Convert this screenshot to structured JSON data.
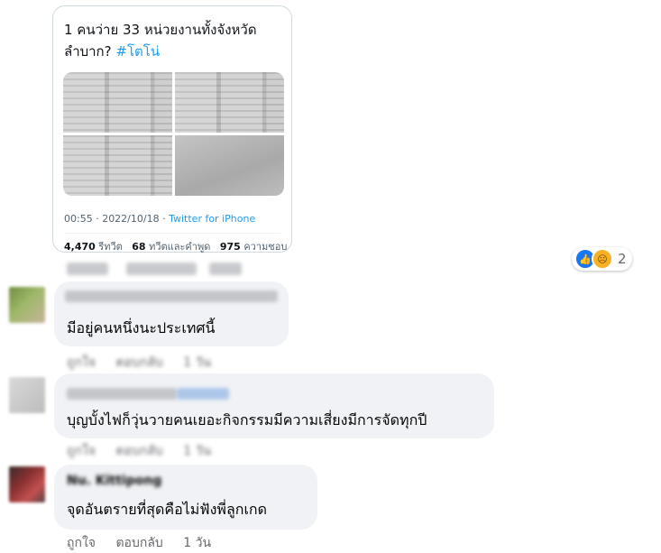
{
  "tweet": {
    "text": "1 คนว่าย 33 หน่วยงานทั้งจังหวัด ลำบาก?",
    "hashtag": "#โตโน่",
    "time": "00:55 · 2022/10/18 · ",
    "source": "Twitter for iPhone",
    "retweets_count": "4,470",
    "retweets_label": "รีทวีต",
    "quotes_count": "68",
    "quotes_label": "ทวีตและคำพูด",
    "likes_count": "975",
    "likes_label": "ความชอบ"
  },
  "reactions": {
    "icons": [
      "like-icon",
      "sad-icon"
    ],
    "count": "2"
  },
  "comments": [
    {
      "text": "มีอยู่คนหนึ่งนะประเทศนี้",
      "like_label": "ถูกใจ",
      "reply_label": "ตอบกลับ",
      "time": "1 วัน"
    },
    {
      "text": "บุญบั้งไฟก็วุ่นวายคนเยอะกิจกรรมมีความเสี่ยงมีการจัดทุกปี",
      "like_label": "ถูกใจ",
      "reply_label": "ตอบกลับ",
      "time": "1 วัน"
    },
    {
      "author": "Nu. Kittipong",
      "text": "จุดอันตรายที่สุดคือไม่ฟังพี่ลูกเกด",
      "like_label": "ถูกใจ",
      "reply_label": "ตอบกลับ",
      "time": "1 วัน"
    }
  ],
  "colors": {
    "accent_blue": "#1d9bf0",
    "facebook_blue": "#1877f2",
    "bubble_bg": "#f0f2f5",
    "muted_text": "#65676b"
  }
}
